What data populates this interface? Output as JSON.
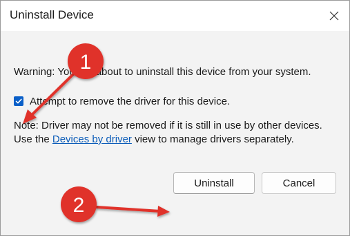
{
  "window": {
    "title": "Uninstall Device"
  },
  "content": {
    "warning": "Warning: You are about to uninstall this device from your system.",
    "checkbox_label": "Attempt to remove the driver for this device.",
    "checkbox_checked": true,
    "note_prefix": "Note: Driver may not be removed if it is still in use by other devices. Use the ",
    "note_link": "Devices by driver",
    "note_suffix": " view to manage drivers separately."
  },
  "buttons": {
    "uninstall": "Uninstall",
    "cancel": "Cancel"
  },
  "annotations": {
    "badge_1": "1",
    "badge_2": "2",
    "color": "#e0312b"
  },
  "icons": {
    "close": "close-icon",
    "check": "checkmark-icon"
  }
}
